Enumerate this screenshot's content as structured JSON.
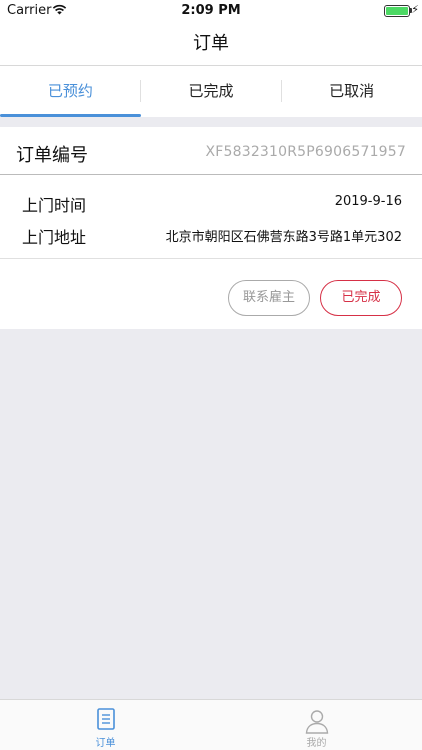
{
  "status_bar": {
    "carrier": "Carrier",
    "time": "2:09 PM"
  },
  "nav": {
    "title": "订单"
  },
  "tabs": [
    {
      "label": "已预约",
      "active": true
    },
    {
      "label": "已完成",
      "active": false
    },
    {
      "label": "已取消",
      "active": false
    }
  ],
  "order": {
    "number_label": "订单编号",
    "number_value": "XF5832310R5P6906571957",
    "time_label": "上门时间",
    "time_value": "2019-9-16",
    "address_label": "上门地址",
    "address_value": "北京市朝阳区石佛营东路3号路1单元302",
    "contact_button": "联系雇主",
    "done_button": "已完成"
  },
  "tab_bar": [
    {
      "label": "订单",
      "icon": "document-icon",
      "active": true
    },
    {
      "label": "我的",
      "icon": "user-icon",
      "active": false
    }
  ],
  "colors": {
    "accent": "#4a90d9",
    "danger": "#d63046",
    "battery": "#4cd964"
  }
}
